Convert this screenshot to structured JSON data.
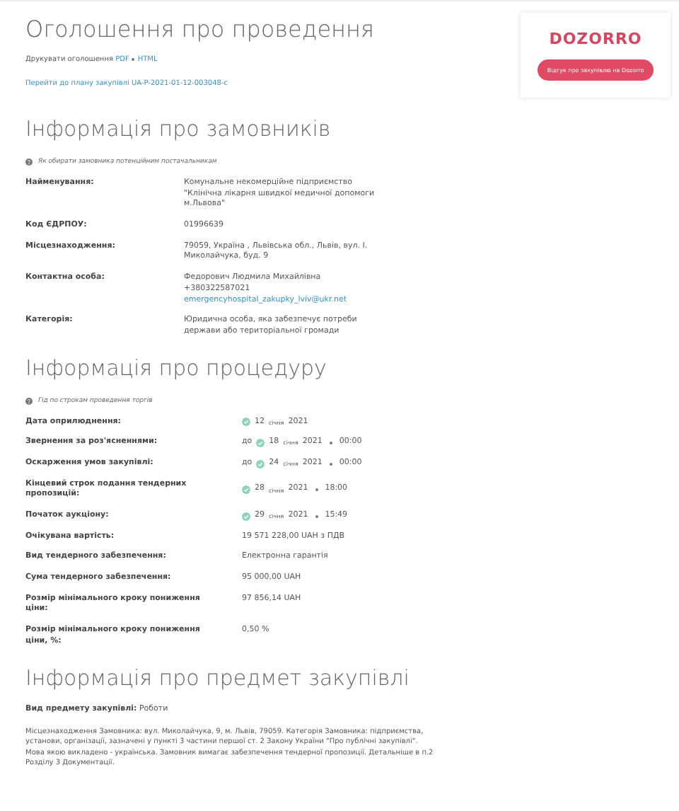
{
  "header": {
    "title": "Оголошення про проведення",
    "print_label": "Друкувати оголошення",
    "print_links": [
      "PDF",
      "HTML"
    ],
    "plan_link": "Перейти до плану закупівлі UA-P-2021-01-12-003048-c"
  },
  "dozorro": {
    "logo": "DOZORRO",
    "button": "Відгук про закупівлю на Dozorro"
  },
  "customer": {
    "heading": "Інформація про замовників",
    "hint": "Як обирати замовника потенційним постачальникам",
    "rows": [
      {
        "label": "Найменування:",
        "lines": [
          "Комунальне некомерційне підприємство",
          "\"Клінічна лікарня швидкої медичної допомоги",
          "м.Львова\""
        ]
      },
      {
        "label": "Код ЄДРПОУ:",
        "lines": [
          "01996639"
        ]
      },
      {
        "label": "Місцезнаходження:",
        "lines": [
          "79059, Україна , Львівська обл., Львів, вул. І.",
          "Миколайчука, буд. 9"
        ]
      },
      {
        "label": "Контактна особа:",
        "lines": [
          "Федорович Людмила Михайлівна",
          "+380322587021"
        ],
        "email": "emergencyhospital_zakupky_lviv@ukr.net"
      },
      {
        "label": "Категорія:",
        "lines": [
          "Юридична особа, яка забезпечує потреби",
          "держави або територіальної громади"
        ]
      }
    ]
  },
  "procedure": {
    "heading": "Інформація про процедуру",
    "hint": "Гід по строкам проведення торгів",
    "rows": [
      {
        "kind": "date",
        "label": "Дата оприлюднення:",
        "day": "12",
        "month": "січня",
        "year": "2021"
      },
      {
        "kind": "date",
        "label": "Звернення за роз'ясненнями:",
        "prefix": "до",
        "day": "18",
        "month": "січня",
        "year": "2021",
        "time": "00:00"
      },
      {
        "kind": "date",
        "label": "Оскарження умов закупівлі:",
        "prefix": "до",
        "day": "24",
        "month": "січня",
        "year": "2021",
        "time": "00:00"
      },
      {
        "kind": "date",
        "label": "Кінцевий строк подання тендерних пропозицій:",
        "day": "28",
        "month": "січня",
        "year": "2021",
        "time": "18:00"
      },
      {
        "kind": "date",
        "label": "Початок аукціону:",
        "day": "29",
        "month": "січня",
        "year": "2021",
        "time": "15:49"
      },
      {
        "kind": "text",
        "label": "Очікувана вартість:",
        "value": "19 571 228,00 UAH з ПДВ"
      },
      {
        "kind": "text",
        "label": "Вид тендерного забезпечення:",
        "value": "Електронна гарантія"
      },
      {
        "kind": "text",
        "label": "Сума тендерного забезпечення:",
        "value": "95 000,00 UAH"
      },
      {
        "kind": "text",
        "label": "Розмір мінімального кроку пониження ціни:",
        "value": "97 856,14 UAH"
      },
      {
        "kind": "text",
        "label": "Розмір мінімального кроку пониження ціни, %:",
        "value": "0,50 %"
      }
    ]
  },
  "subject": {
    "heading": "Інформація про предмет закупівлі",
    "type_label": "Вид предмету закупівлі:",
    "type_value": "Роботи",
    "description": "Місцезнаходження Замовника: вул. Миколайчука, 9, м. Львів, 79059. Категорія Замовника: підприємства, установи, організації, зазначені у пункті 3 частини першої ст. 2 Закону України \"Про публічні закупівлі\". Мова якою викладено - українська. Замовник вимагає забезпечення тендерної пропозиції. Детальніше в п.2 Розділу 3 Документації."
  }
}
